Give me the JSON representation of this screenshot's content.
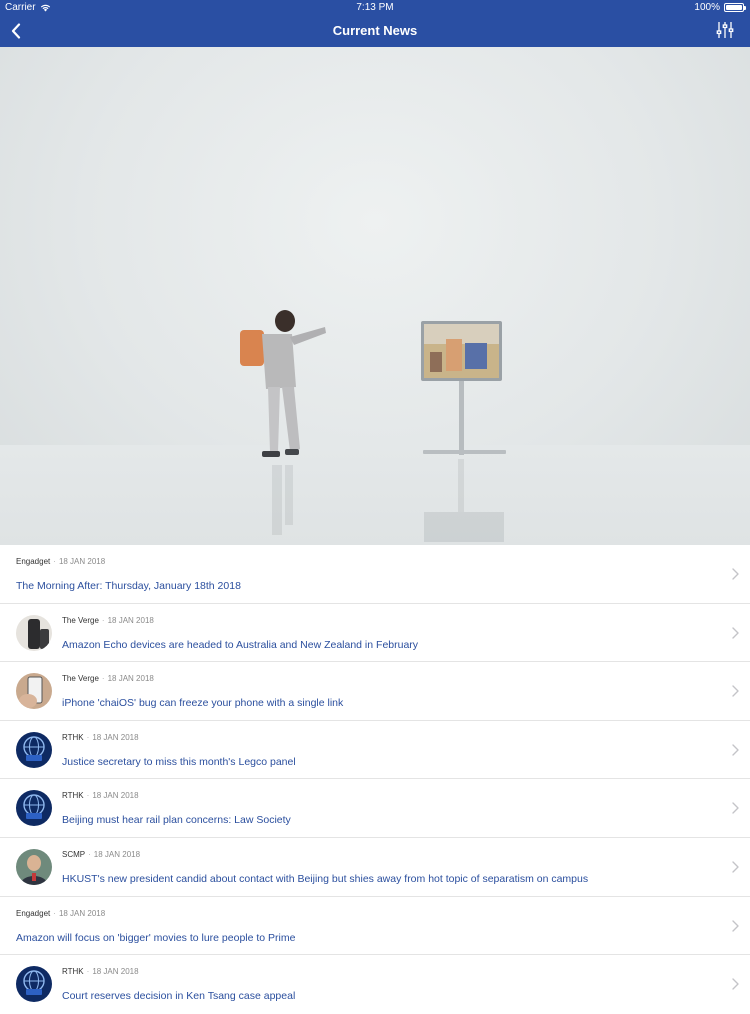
{
  "status_bar": {
    "carrier": "Carrier",
    "time": "7:13 PM",
    "battery": "100%",
    "battery_level": 1.0
  },
  "nav": {
    "title": "Current News",
    "back_icon": "chevron-left-icon",
    "filter_icon": "sliders-icon"
  },
  "colors": {
    "nav_background": "#2a4fa3",
    "headline": "#2b4f9e",
    "date": "#8a8a8a"
  },
  "articles": [
    {
      "source": "Engadget",
      "date": "18 JAN 2018",
      "headline": "The Morning After: Thursday, January 18th 2018",
      "thumbnail": ""
    },
    {
      "source": "The Verge",
      "date": "18 JAN 2018",
      "headline": "Amazon Echo devices are headed to Australia and New Zealand in February",
      "thumbnail": "echo-device"
    },
    {
      "source": "The Verge",
      "date": "18 JAN 2018",
      "headline": "iPhone 'chaiOS' bug can freeze your phone with a single link",
      "thumbnail": "phone-in-hand"
    },
    {
      "source": "RTHK",
      "date": "18 JAN 2018",
      "headline": "Justice secretary to miss this month's Legco panel",
      "thumbnail": "globe-news"
    },
    {
      "source": "RTHK",
      "date": "18 JAN 2018",
      "headline": "Beijing must hear rail plan concerns: Law Society",
      "thumbnail": "globe-news"
    },
    {
      "source": "SCMP",
      "date": "18 JAN 2018",
      "headline": "HKUST's new president candid about contact with Beijing but shies away from hot topic of separatism on campus",
      "thumbnail": "portrait"
    },
    {
      "source": "Engadget",
      "date": "18 JAN 2018",
      "headline": "Amazon will focus on 'bigger' movies to lure people to Prime",
      "thumbnail": ""
    },
    {
      "source": "RTHK",
      "date": "18 JAN 2018",
      "headline": "Court reserves decision in Ken Tsang case appeal",
      "thumbnail": "globe-news"
    }
  ]
}
